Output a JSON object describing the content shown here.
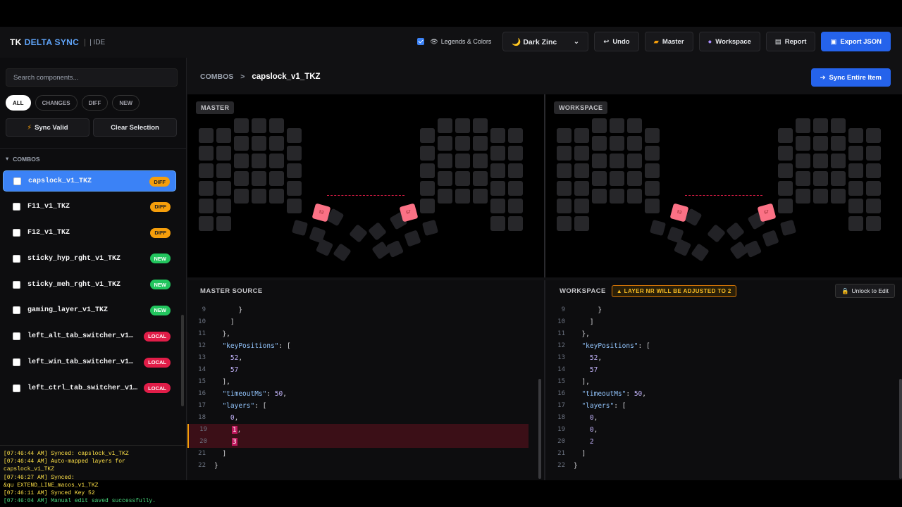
{
  "header": {
    "brand_a": "TK",
    "brand_b": "DELTA SYNC",
    "brand_c": "| IDE",
    "legends_label": "Legends & Colors",
    "theme": "Dark Zinc",
    "undo": "Undo",
    "master": "Master",
    "workspace": "Workspace",
    "report": "Report",
    "export": "Export JSON"
  },
  "sidebar": {
    "search_placeholder": "Search components...",
    "filters": [
      "ALL",
      "CHANGES",
      "DIFF",
      "NEW"
    ],
    "sync_valid": "Sync Valid",
    "clear_selection": "Clear Selection",
    "section": "COMBOS",
    "items": [
      {
        "label": "capslock_v1_TKZ",
        "badge": "DIFF"
      },
      {
        "label": "F11_v1_TKZ",
        "badge": "DIFF"
      },
      {
        "label": "F12_v1_TKZ",
        "badge": "DIFF"
      },
      {
        "label": "sticky_hyp_rght_v1_TKZ",
        "badge": "NEW"
      },
      {
        "label": "sticky_meh_rght_v1_TKZ",
        "badge": "NEW"
      },
      {
        "label": "gaming_layer_v1_TKZ",
        "badge": "NEW"
      },
      {
        "label": "left_alt_tab_switcher_v1…",
        "badge": "LOCAL"
      },
      {
        "label": "left_win_tab_switcher_v1…",
        "badge": "LOCAL"
      },
      {
        "label": "left_ctrl_tab_switcher_v1…",
        "badge": "LOCAL"
      }
    ]
  },
  "log": [
    {
      "text": "[07:46:44 AM] Synced: capslock_v1_TKZ",
      "c": "y"
    },
    {
      "text": "[07:46:44 AM] Auto-mapped layers for",
      "c": "y"
    },
    {
      "text": "capslock_v1_TKZ",
      "c": "y"
    },
    {
      "text": "[07:46:27 AM] Synced:",
      "c": "y"
    },
    {
      "text": "&qu EXTEND_LINE_macos_v1_TKZ",
      "c": "y"
    },
    {
      "text": "[07:46:11 AM] Synced Key 52",
      "c": "y"
    },
    {
      "text": "[07:46:04 AM] Manual edit saved successfully.",
      "c": "g"
    }
  ],
  "main": {
    "crumb_root": "COMBOS",
    "crumb_sep": ">",
    "crumb_current": "capslock_v1_TKZ",
    "sync_entire": "Sync Entire Item",
    "master_label": "MASTER",
    "workspace_label": "WORKSPACE",
    "combo_key_a": "52",
    "combo_key_b": "57",
    "master_source": "MASTER SOURCE",
    "workspace_source": "WORKSPACE",
    "warning": "LAYER NR WILL BE ADJUSTED TO 2",
    "unlock": "Unlock to Edit"
  },
  "master_code": [
    {
      "n": "9",
      "t": "      }"
    },
    {
      "n": "10",
      "t": "    ]"
    },
    {
      "n": "11",
      "t": "  },"
    },
    {
      "n": "12",
      "t": "  \"keyPositions\": ["
    },
    {
      "n": "13",
      "t": "    52,"
    },
    {
      "n": "14",
      "t": "    57"
    },
    {
      "n": "15",
      "t": "  ],"
    },
    {
      "n": "16",
      "t": "  \"timeoutMs\": 50,"
    },
    {
      "n": "17",
      "t": "  \"layers\": ["
    },
    {
      "n": "18",
      "t": "    0,"
    },
    {
      "n": "19",
      "t": "    1,"
    },
    {
      "n": "20",
      "t": "    3"
    },
    {
      "n": "21",
      "t": "  ]"
    },
    {
      "n": "22",
      "t": "}"
    }
  ],
  "workspace_code": [
    {
      "n": "9",
      "t": "      }"
    },
    {
      "n": "10",
      "t": "    ]"
    },
    {
      "n": "11",
      "t": "  },"
    },
    {
      "n": "12",
      "t": "  \"keyPositions\": ["
    },
    {
      "n": "13",
      "t": "    52,"
    },
    {
      "n": "14",
      "t": "    57"
    },
    {
      "n": "15",
      "t": "  ],"
    },
    {
      "n": "16",
      "t": "  \"timeoutMs\": 50,"
    },
    {
      "n": "17",
      "t": "  \"layers\": ["
    },
    {
      "n": "18",
      "t": "    0,"
    },
    {
      "n": "19",
      "t": "    0,"
    },
    {
      "n": "20",
      "t": "    2"
    },
    {
      "n": "21",
      "t": "  ]"
    },
    {
      "n": "22",
      "t": "}"
    }
  ]
}
